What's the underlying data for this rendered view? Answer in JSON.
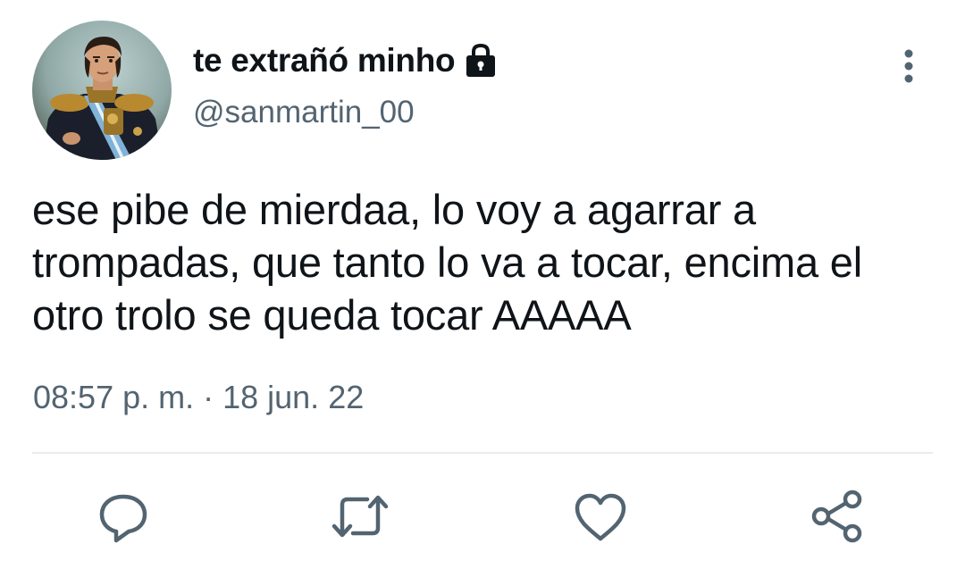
{
  "tweet": {
    "author": {
      "display_name": "te extrañó minho",
      "handle": "@sanmartin_00",
      "protected_icon": "lock-icon",
      "avatar_icon": "avatar-portrait"
    },
    "text": "ese pibe de mierdaa, lo voy a agarrar a trompadas, que tanto lo va a tocar, encima el otro trolo se queda tocar AAAAA",
    "timestamp": "08:57 p. m. · 18 jun. 22",
    "menu_icon": "more-vertical-icon"
  },
  "actions": [
    {
      "name": "reply",
      "icon": "reply-icon"
    },
    {
      "name": "retweet",
      "icon": "retweet-icon"
    },
    {
      "name": "like",
      "icon": "heart-icon"
    },
    {
      "name": "share",
      "icon": "share-icon"
    }
  ],
  "colors": {
    "text_primary": "#0f1419",
    "text_secondary": "#536471",
    "icon_gray": "#536471",
    "divider": "#e7ecf0"
  }
}
